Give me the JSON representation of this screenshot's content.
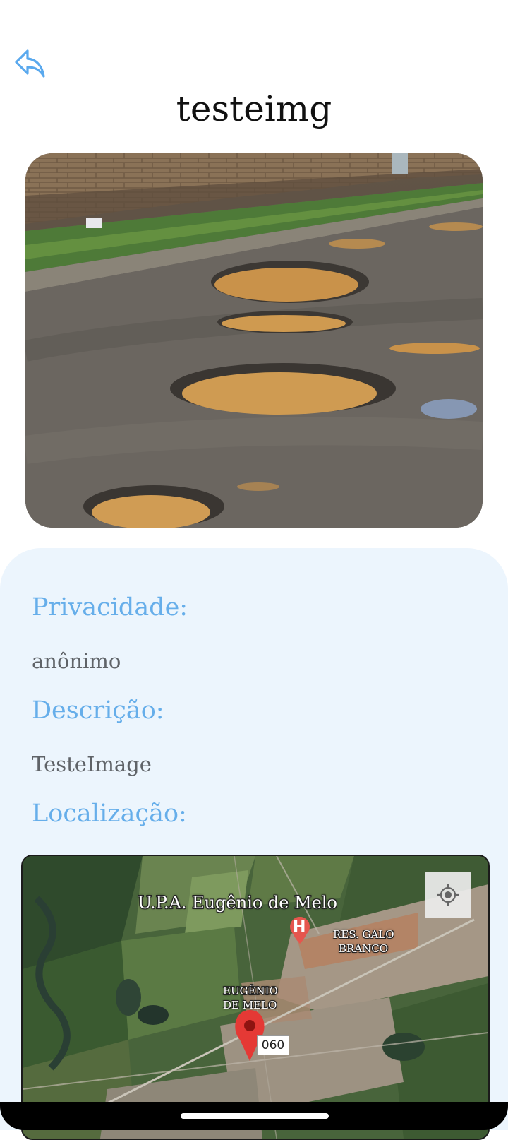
{
  "header": {
    "title": "testeimg",
    "back_icon": "reply-arrow-icon"
  },
  "details": {
    "privacy_label": "Privacidade:",
    "privacy_value": "anônimo",
    "description_label": "Descrição:",
    "description_value": "TesteImage",
    "location_label": "Localização:"
  },
  "map": {
    "poi_name": "U.P.A. Eugênio de Melo",
    "area_label_1_line1": "RES. GALO",
    "area_label_1_line2": "BRANCO",
    "area_label_2_line1": "EUGÊNIO",
    "area_label_2_line2": "DE MELO",
    "road_badge": "060",
    "hospital_marker_letter": "H",
    "locate_icon": "my-location-icon",
    "pin_icon": "map-pin-icon"
  },
  "colors": {
    "accent": "#66aeea",
    "panel_bg": "#ecf5fd",
    "value_text": "#5f6368",
    "pin_red": "#e53935"
  }
}
